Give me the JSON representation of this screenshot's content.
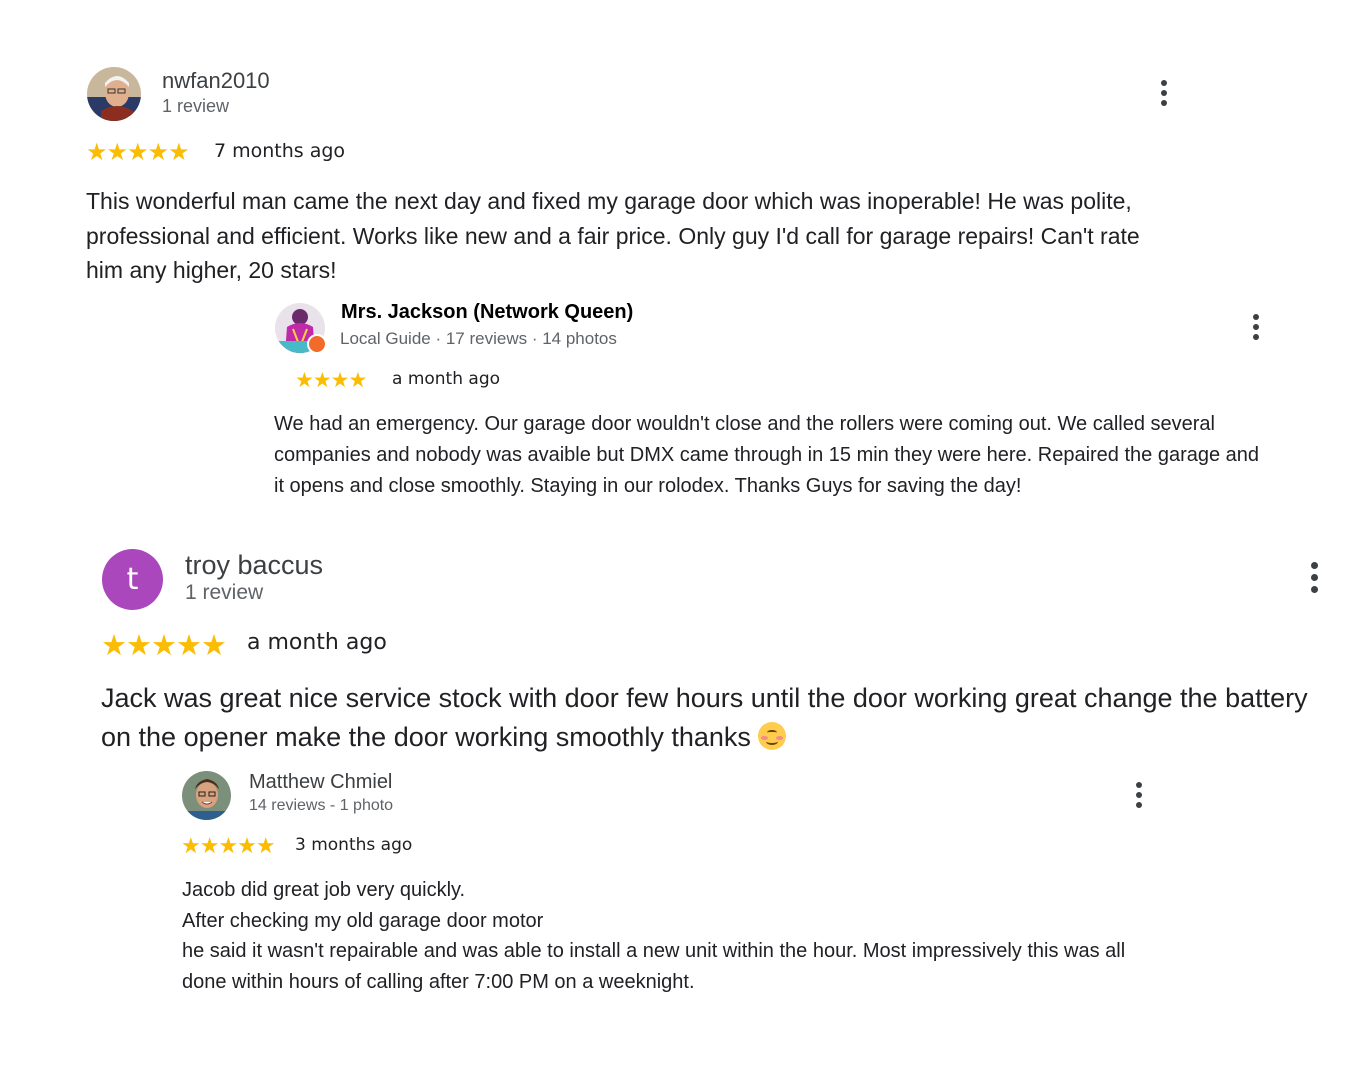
{
  "reviews": [
    {
      "author": "nwfan2010",
      "meta": "1 review",
      "stars": "★★★★★",
      "time": "7 months ago",
      "text": [
        "This wonderful man came the next day and fixed my garage door which was inoperable! He was polite, professional and efficient. Works like new and a fair price. Only guy I'd call for garage repairs! Can't rate him any higher, 20 stars!"
      ],
      "avatar_icon": "profile-photo"
    },
    {
      "author": "Mrs. Jackson (Network Queen)",
      "meta": "Local Guide · 17 reviews · 14 photos",
      "stars": "★★★★",
      "time": "a month ago",
      "text": [
        "We had an emergency. Our garage door wouldn't close and the rollers were coming out. We called several companies and nobody was avaible but DMX came through in 15 min they were here. Repaired the garage and it opens and close smoothly. Staying in our rolodex. Thanks Guys for saving the day!"
      ],
      "avatar_icon": "local-guide-avatar"
    },
    {
      "author": "troy baccus",
      "meta": "1 review",
      "stars": "★★★★★",
      "time": "a month ago",
      "avatar_letter": "t",
      "avatar_color": "#ab47bc",
      "text": [
        "Jack was great nice service stock with door few hours until the door working great change the battery on the opener make the door working smoothly thanks"
      ],
      "emoji_icon": "smiling-face-with-blush-emoji"
    },
    {
      "author": "Matthew Chmiel",
      "meta": "14 reviews - 1 photo",
      "stars": "★★★★★",
      "time": "3 months ago",
      "text": [
        "Jacob did great job very quickly.",
        "After checking my old garage door motor",
        "he said it wasn't repairable and was able to install a new unit within the hour. Most impressively this was all done within hours of calling after 7:00 PM on a weeknight."
      ],
      "avatar_icon": "profile-photo"
    }
  ],
  "colors": {
    "star": "#fbbc04",
    "text": "#202124",
    "secondary": "#5f6368",
    "avatar_purple": "#ab47bc"
  },
  "menu_icon": "more-vert-icon"
}
